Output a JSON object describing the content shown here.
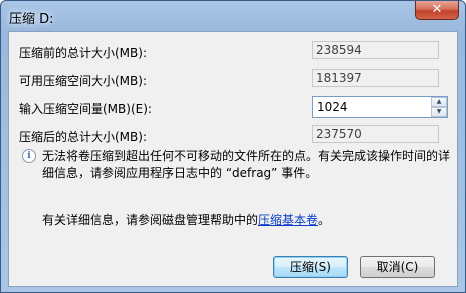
{
  "window": {
    "title": "压缩 D:",
    "close_glyph": "✕"
  },
  "fields": {
    "total_before": {
      "label": "压缩前的总计大小(MB):",
      "value": "238594"
    },
    "available": {
      "label": "可用压缩空间大小(MB):",
      "value": "181397"
    },
    "shrink_amount": {
      "label": "输入压缩空间量(MB)(E):",
      "value": "1024"
    },
    "total_after": {
      "label": "压缩后的总计大小(MB):",
      "value": "237570"
    }
  },
  "note": {
    "icon": "info-icon",
    "text": "无法将卷压缩到超出任何不可移动的文件所在的点。有关完成该操作时间的详细信息，请参阅应用程序日志中的 “defrag” 事件。"
  },
  "help": {
    "text": "有关详细信息，请参阅磁盘管理帮助中的",
    "link": "压缩基本卷",
    "suffix": "。"
  },
  "buttons": {
    "shrink": "压缩(S)",
    "cancel": "取消(C)"
  }
}
